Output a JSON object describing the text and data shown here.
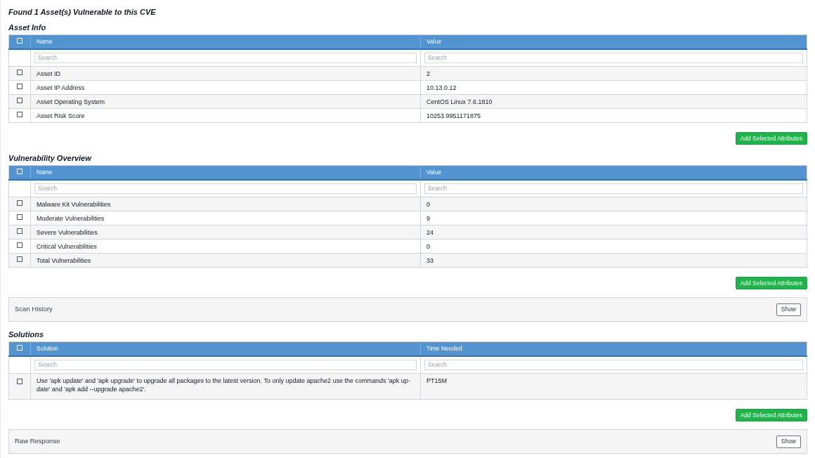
{
  "title": "Found 1 Asset(s) Vulnerable to this CVE",
  "sections": [
    {
      "kind": "table",
      "heading": "Asset Info",
      "select_all_checked": false,
      "columns": [
        {
          "label": "Name",
          "placeholder": "Search"
        },
        {
          "label": "Value",
          "placeholder": "Search"
        }
      ],
      "rows": [
        {
          "checked": false,
          "cells": [
            "Asset ID",
            "2"
          ]
        },
        {
          "checked": false,
          "cells": [
            "Asset IP Address",
            "10.13.0.12"
          ]
        },
        {
          "checked": false,
          "cells": [
            "Asset Operating System",
            "CentOS Linux 7.6.1810"
          ]
        },
        {
          "checked": false,
          "cells": [
            "Asset Risk Score",
            "10253.9951171875"
          ]
        }
      ],
      "button": "Add Selected Attributes"
    },
    {
      "kind": "table",
      "heading": "Vulnerability Overview",
      "select_all_checked": false,
      "columns": [
        {
          "label": "Name",
          "placeholder": "Search"
        },
        {
          "label": "Value",
          "placeholder": "Search"
        }
      ],
      "rows": [
        {
          "checked": false,
          "cells": [
            "Malware Kit Vulnerabilities",
            "0"
          ]
        },
        {
          "checked": false,
          "cells": [
            "Moderate Vulnerabilities",
            "9"
          ]
        },
        {
          "checked": false,
          "cells": [
            "Severe Vulnerabilities",
            "24"
          ]
        },
        {
          "checked": false,
          "cells": [
            "Critical Vulnerabilities",
            "0"
          ]
        },
        {
          "checked": false,
          "cells": [
            "Total Vulnerabilities",
            "33"
          ]
        }
      ],
      "button": "Add Selected Attributes"
    },
    {
      "kind": "panel",
      "label": "Scan History",
      "button": "Show"
    },
    {
      "kind": "table",
      "heading": "Solutions",
      "select_all_checked": false,
      "columns": [
        {
          "label": "Solution",
          "placeholder": "Search"
        },
        {
          "label": "Time Needed",
          "placeholder": "Search"
        }
      ],
      "rows": [
        {
          "checked": false,
          "cells": [
            "Use 'apk update' and 'apk upgrade' to upgrade all packages to the latest version. To only update apache2 use the commands 'apk up-date' and 'apk add --upgrade apache2'.",
            "PT15M"
          ]
        }
      ],
      "button": "Add Selected Attributes"
    },
    {
      "kind": "panel",
      "label": "Raw Response",
      "button": "Show"
    }
  ]
}
